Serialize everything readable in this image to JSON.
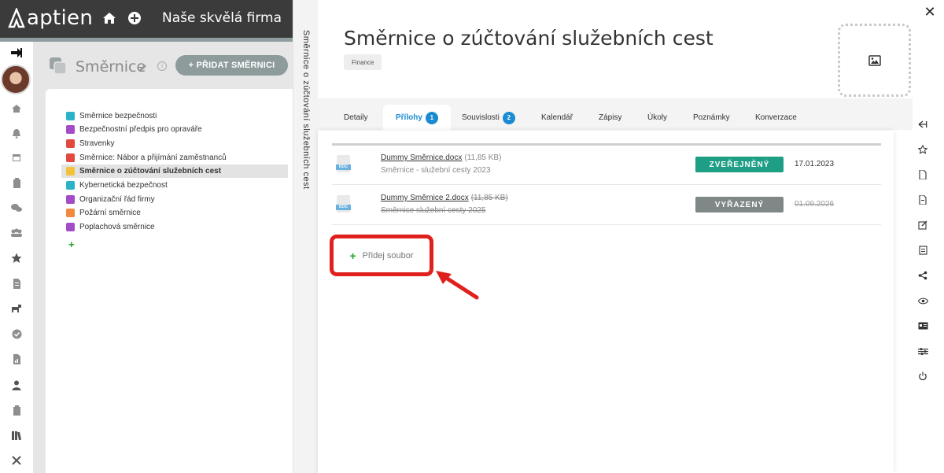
{
  "app": {
    "logo_text": "aptien",
    "company": "Naše skvělá firma"
  },
  "left_panel": {
    "title": "Směrnice",
    "info_mark": "i",
    "add_button": "+ PŘIDAT SMĚRNICI",
    "items": [
      {
        "label": "Směrnice bezpečnosti",
        "color": "#2ab3c6"
      },
      {
        "label": "Bezpečnostní předpis pro opraváře",
        "color": "#a44bc8"
      },
      {
        "label": "Stravenky",
        "color": "#e3483f"
      },
      {
        "label": "Směrnice: Nábor a přijímání zaměstnanců",
        "color": "#e3483f"
      },
      {
        "label": "Směrnice o zúčtování služebních cest",
        "color": "#f2c23a",
        "selected": true
      },
      {
        "label": "Kybernetická bezpečnost",
        "color": "#2ab3c6"
      },
      {
        "label": "Organizační řád firmy",
        "color": "#a44bc8"
      },
      {
        "label": "Požární směrnice",
        "color": "#f08a3c"
      },
      {
        "label": "Poplachová směrnice",
        "color": "#a44bc8"
      }
    ],
    "add_item": "+"
  },
  "detail": {
    "vertical_title": "Směrnice o zúčtování služebních cest",
    "title": "Směrnice o zúčtování služebních cest",
    "tag": "Finance",
    "tabs": [
      {
        "label": "Detaily"
      },
      {
        "label": "Přílohy",
        "badge": "1",
        "active": true
      },
      {
        "label": "Souvislosti",
        "badge": "2"
      },
      {
        "label": "Kalendář"
      },
      {
        "label": "Zápisy"
      },
      {
        "label": "Úkoly"
      },
      {
        "label": "Poznámky"
      },
      {
        "label": "Konverzace"
      }
    ],
    "files": [
      {
        "name": "Dummy Směrnice.docx",
        "size": "(11,85 KB)",
        "description": "Směrnice - služební cesty 2023",
        "status": "ZVEŘEJNĚNÝ",
        "status_color": "#1e9e85",
        "date": "17.01.2023",
        "icon_label": "DOC"
      },
      {
        "name": "Dummy Směrnice 2.docx",
        "size": "(11,85 KB)",
        "description": "Směrnice služební cesty 2025",
        "status": "VYŘAZENÝ",
        "status_color": "#7f8787",
        "date": "01.09.2026",
        "icon_label": "DOC"
      }
    ],
    "add_file": "Přidej soubor"
  },
  "colors": {
    "accent": "#1a8bd0",
    "highlight": "#e0201c",
    "add_button": "#8d9b9b"
  },
  "close_symbol": "✕"
}
